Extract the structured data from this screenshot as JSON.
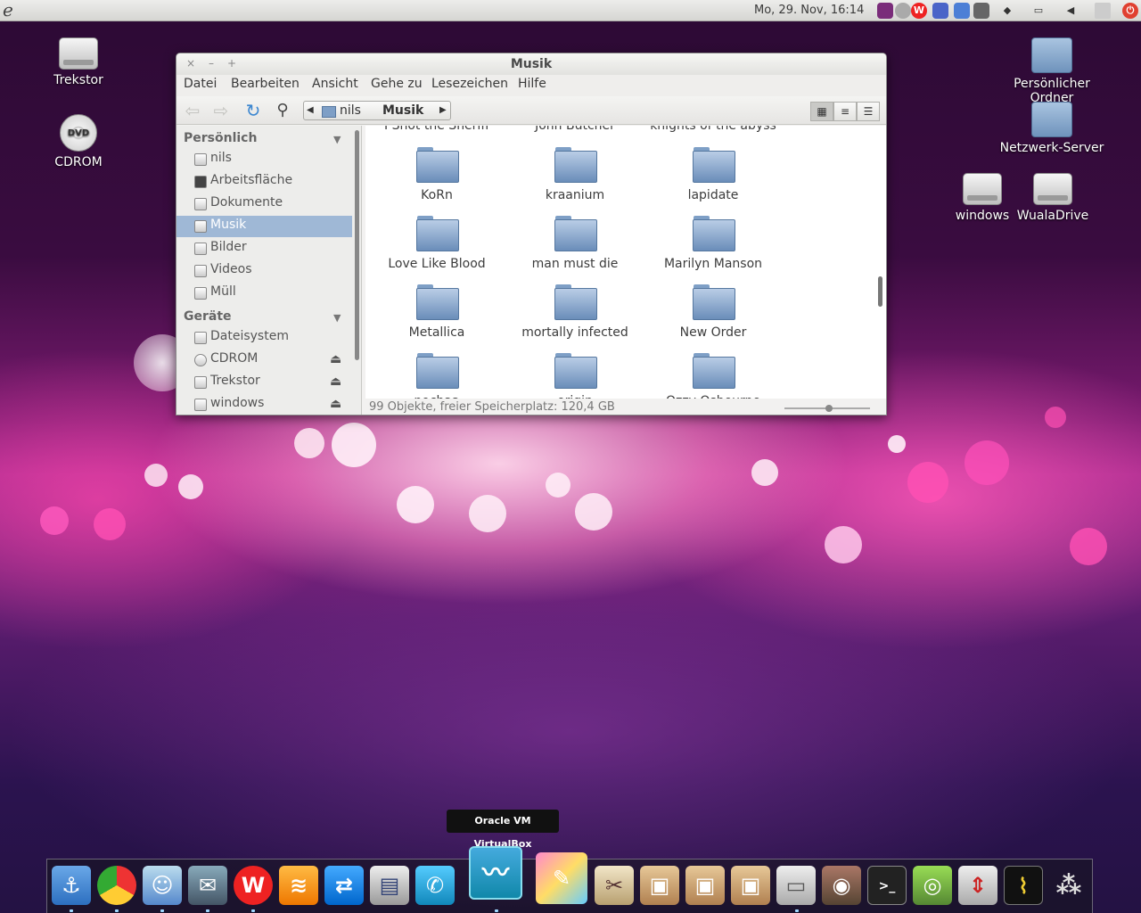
{
  "top_panel": {
    "clock": "Mo, 29. Nov, 16:14",
    "tray_icons": [
      "indicator-icon",
      "network-icon",
      "w-app-icon",
      "im-icon",
      "dropbox-icon",
      "brush-icon",
      "transfer-icon",
      "battery-icon",
      "volume-icon",
      "mail-icon",
      "power-icon"
    ]
  },
  "desktop": {
    "left_icons": [
      "Trekstor",
      "CDROM"
    ],
    "right_icons": [
      "Persönlicher Ordner",
      "Netzwerk-Server",
      "windows",
      "WualaDrive"
    ]
  },
  "window": {
    "title": "Musik",
    "menu": [
      "Datei",
      "Bearbeiten",
      "Ansicht",
      "Gehe zu",
      "Lesezeichen",
      "Hilfe"
    ],
    "path": [
      "nils",
      "Musik"
    ],
    "sidebar": {
      "personal_header": "Persönlich",
      "personal_items": [
        "nils",
        "Arbeitsfläche",
        "Dokumente",
        "Musik",
        "Bilder",
        "Videos",
        "Müll"
      ],
      "devices_header": "Geräte",
      "device_items": [
        "Dateisystem",
        "CDROM",
        "Trekstor",
        "windows"
      ]
    },
    "partial_top_labels": [
      "I Shot the Sheriff",
      "John Butcher",
      "knights of the abyss"
    ],
    "folders": [
      "KoRn",
      "kraanium",
      "lapidate",
      "Love Like Blood",
      "man must die",
      "Marilyn Manson",
      "Metallica",
      "mortally infected",
      "New Order"
    ],
    "partial_bottom_labels": [
      "nochaa",
      "origin",
      "Ozzy Osbourne"
    ],
    "status": "99 Objekte, freier Speicherplatz: 120,4 GB"
  },
  "dock": {
    "tooltip": "Oracle VM VirtualBox",
    "items": [
      "anchor-icon",
      "chrome-icon",
      "robot-icon",
      "stamp-icon",
      "w-app-icon",
      "rss-icon",
      "teamviewer-icon",
      "scanner-icon",
      "skype-icon",
      "virtualbox-icon",
      "paint-icon",
      "tools-icon",
      "package-icon",
      "package-down-icon",
      "package-update-icon",
      "files-icon",
      "speaker-icon",
      "terminal-icon",
      "ubuntu-icon",
      "gear-box-icon",
      "monitor-icon",
      "molecule-icon"
    ],
    "colors": {
      "accent": "#9fb8d6",
      "tooltip_bg": "#111111"
    }
  }
}
